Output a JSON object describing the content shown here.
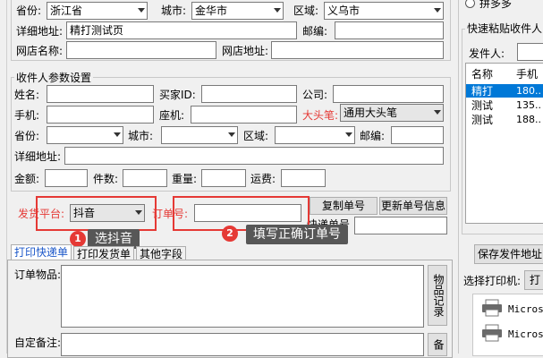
{
  "sender": {
    "province_label": "省份:",
    "province": "浙江省",
    "city_label": "城市:",
    "city": "金华市",
    "district_label": "区域:",
    "district": "义乌市",
    "address_label": "详细地址:",
    "address": "精打测试页",
    "postcode_label": "邮编:",
    "shop_name_label": "网店名称:",
    "shop_url_label": "网店地址:"
  },
  "receiver": {
    "legend": "收件人参数设置",
    "name_label": "姓名:",
    "buyer_id_label": "买家ID:",
    "company_label": "公司:",
    "phone_label": "手机:",
    "landline_label": "座机:",
    "bigpen_label": "大头笔:",
    "bigpen_value": "通用大头笔",
    "province_label": "省份:",
    "city_label": "城市:",
    "district_label": "区域:",
    "postcode_label": "邮编:",
    "address_label": "详细地址:",
    "amount_label": "金额:",
    "pieces_label": "件数:",
    "weight_label": "重量:",
    "freight_label": "运费:"
  },
  "order": {
    "platform_label": "发货平台:",
    "platform_value": "抖音",
    "order_no_label": "订单号:",
    "copy_button": "复制单号",
    "update_button": "更新单号信息",
    "express_no_label": "快递单号"
  },
  "annotations": {
    "step1_num": "1",
    "step1_text": "选抖音",
    "step2_num": "2",
    "step2_text": "填写正确订单号"
  },
  "tabs": [
    "打印快递单",
    "打印发货单",
    "其他字段"
  ],
  "print_area": {
    "items_label": "订单物品:",
    "items_button": "物品记录",
    "remark_label": "自定备注:",
    "remark_button": "备"
  },
  "right_panel": {
    "radio_label": "拼多多",
    "group_title": "快速粘贴收件人",
    "sender_label": "发件人:",
    "table_headers": [
      "名称",
      "手机"
    ],
    "table_rows": [
      {
        "name": "精打",
        "phone": "180.."
      },
      {
        "name": "测试",
        "phone": "135.."
      },
      {
        "name": "测试",
        "phone": "188.."
      }
    ],
    "save_button": "保存发件地址",
    "printer_label": "选择打印机:",
    "printer_button": "打",
    "printers": [
      "Microso",
      "Microso"
    ]
  },
  "colors": {
    "red": "#e53935",
    "selection": "#0078d7",
    "link_blue": "#1a56c8"
  }
}
